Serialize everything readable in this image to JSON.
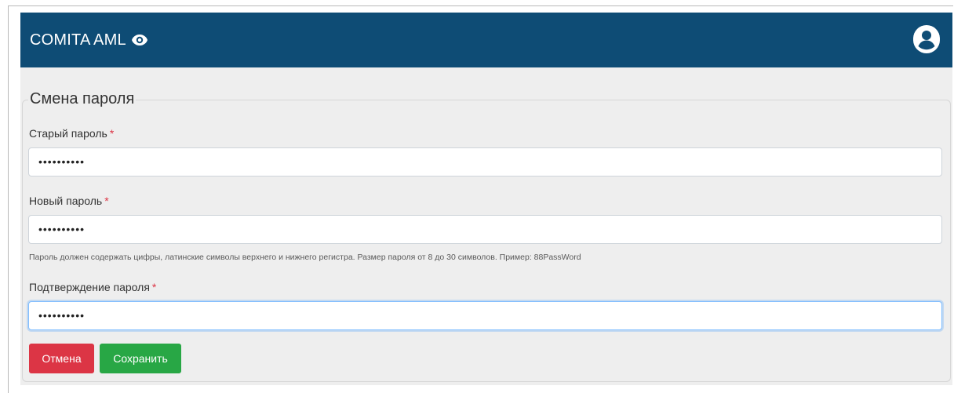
{
  "header": {
    "brand": "COMITA AML",
    "brand_icon": "eye-icon",
    "user_icon": "user-circle-icon",
    "bar_color": "#0e4c75"
  },
  "form": {
    "legend": "Смена пароля",
    "required_mark": "*",
    "old_password": {
      "label": "Старый пароль",
      "value": "••••••••••"
    },
    "new_password": {
      "label": "Новый пароль",
      "value": "••••••••••",
      "hint": "Пароль должен содержать цифры, латинские символы верхнего и нижнего регистра. Размер пароля от 8 до 30 символов. Пример: 88PassWord"
    },
    "confirm_password": {
      "label": "Подтверждение пароля",
      "value": "••••••••••"
    }
  },
  "actions": {
    "cancel_label": "Отмена",
    "save_label": "Сохранить",
    "cancel_color": "#dc3545",
    "save_color": "#28a745"
  }
}
